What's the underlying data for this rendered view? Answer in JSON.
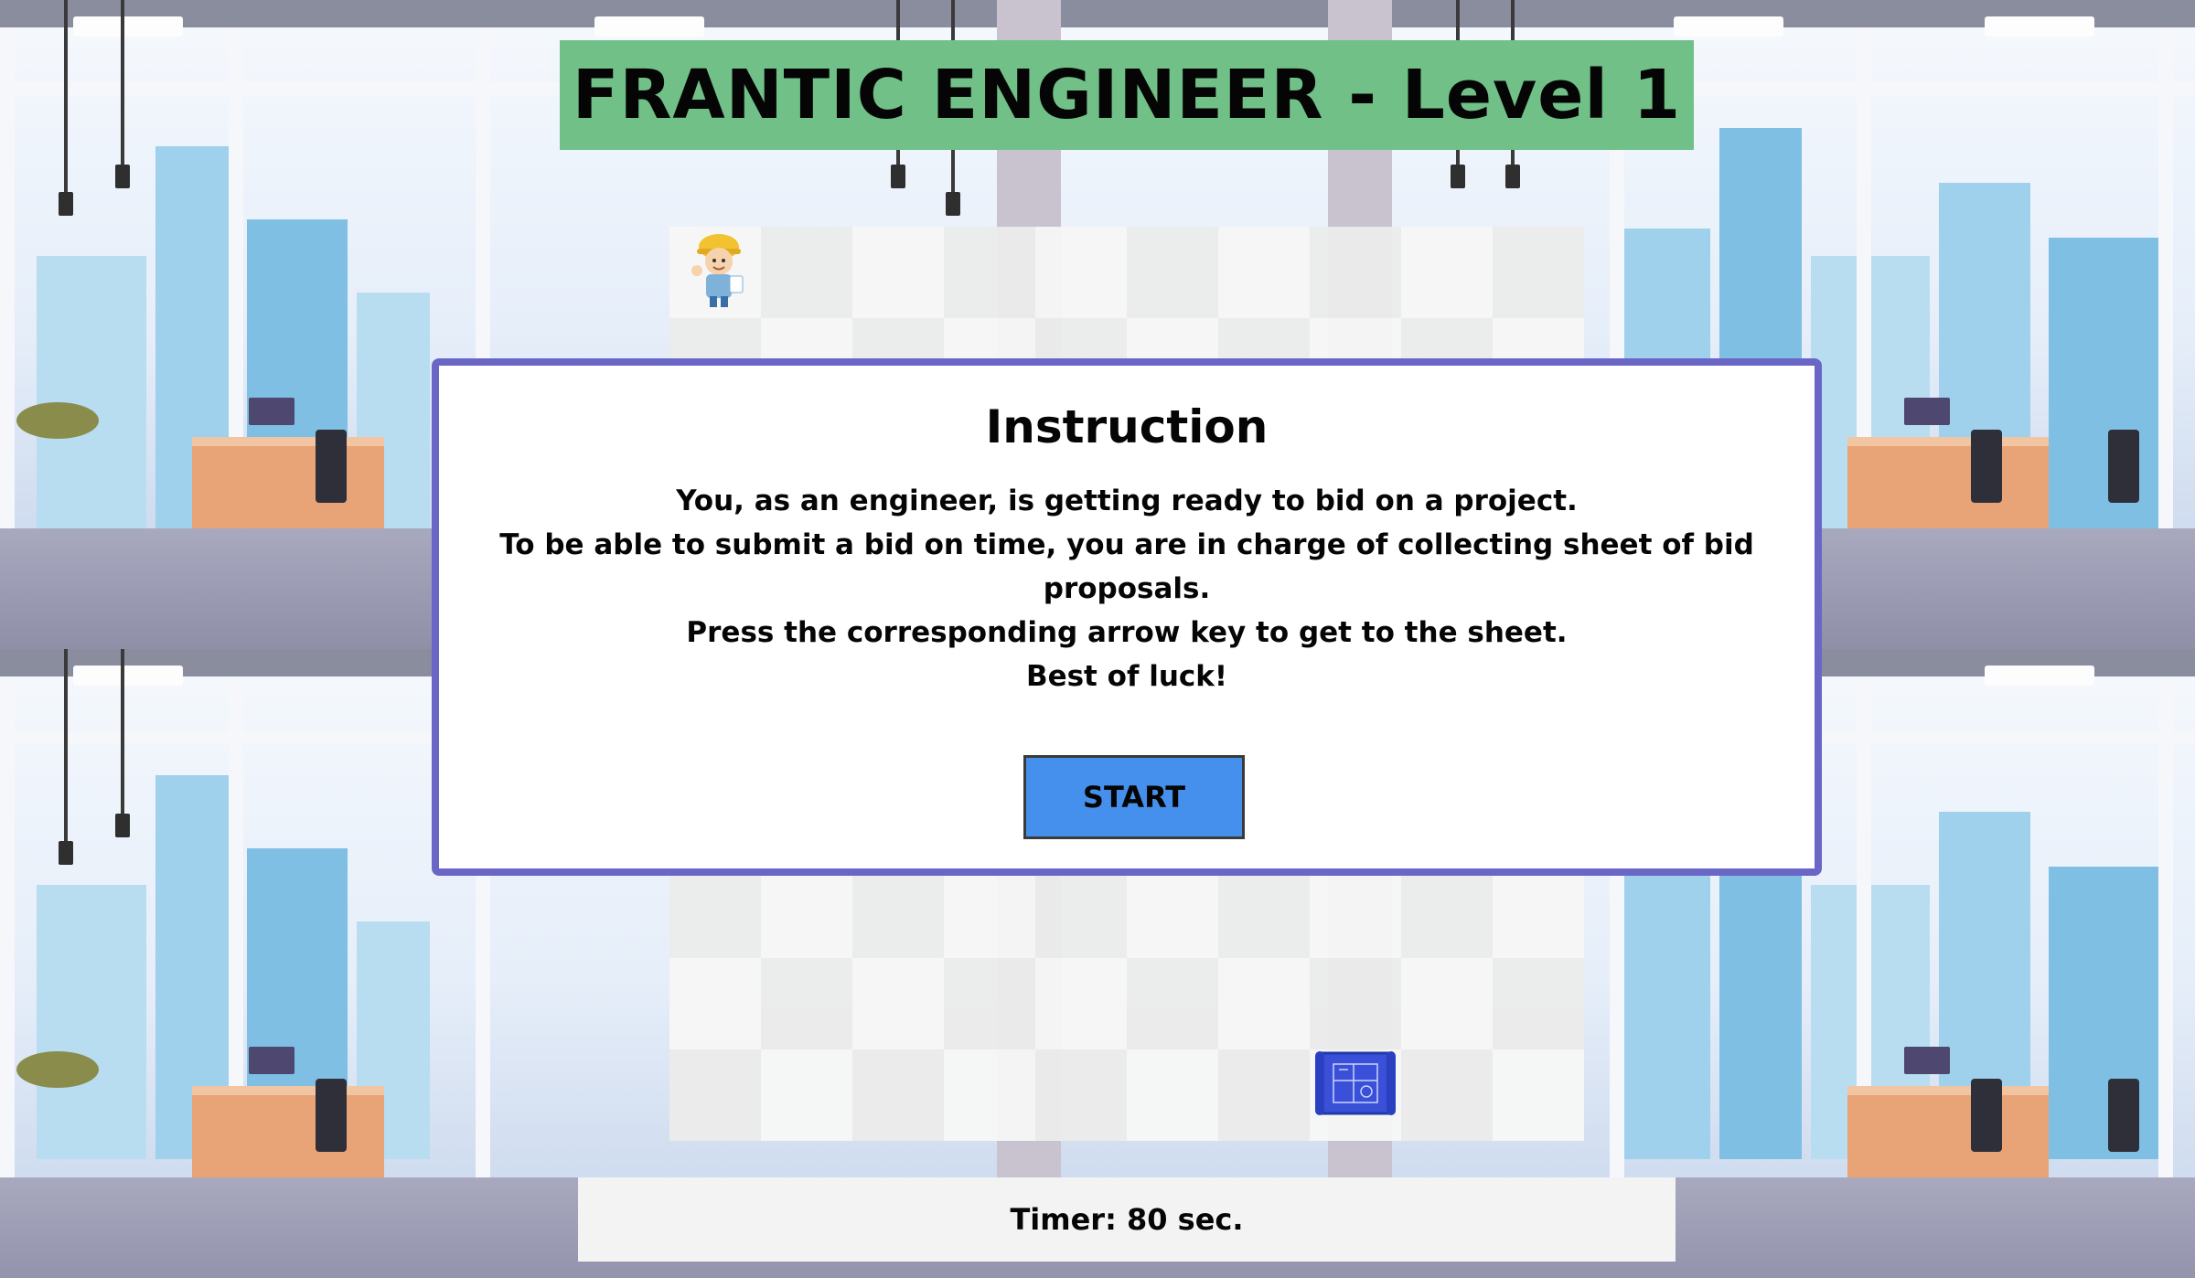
{
  "game": {
    "title": "FRANTIC ENGINEER - Level 1"
  },
  "instruction": {
    "heading": "Instruction",
    "lines": [
      "You, as an engineer, is getting ready to bid on a project.",
      "To be able to submit a bid on time, you are in charge of collecting sheet of bid proposals.",
      "Press the corresponding arrow key to get to the sheet.",
      "Best of luck!"
    ],
    "start_label": "START"
  },
  "timer": {
    "text": "Timer: 80 sec."
  },
  "board": {
    "columns": 10,
    "rows": 10,
    "player_icon": "engineer-icon",
    "target_icon": "blueprint-sheet-icon"
  },
  "colors": {
    "title_bg": "#71c088",
    "modal_border": "#6a66c6",
    "start_button": "#4590ec",
    "timer_bg": "#f3f3f3"
  }
}
